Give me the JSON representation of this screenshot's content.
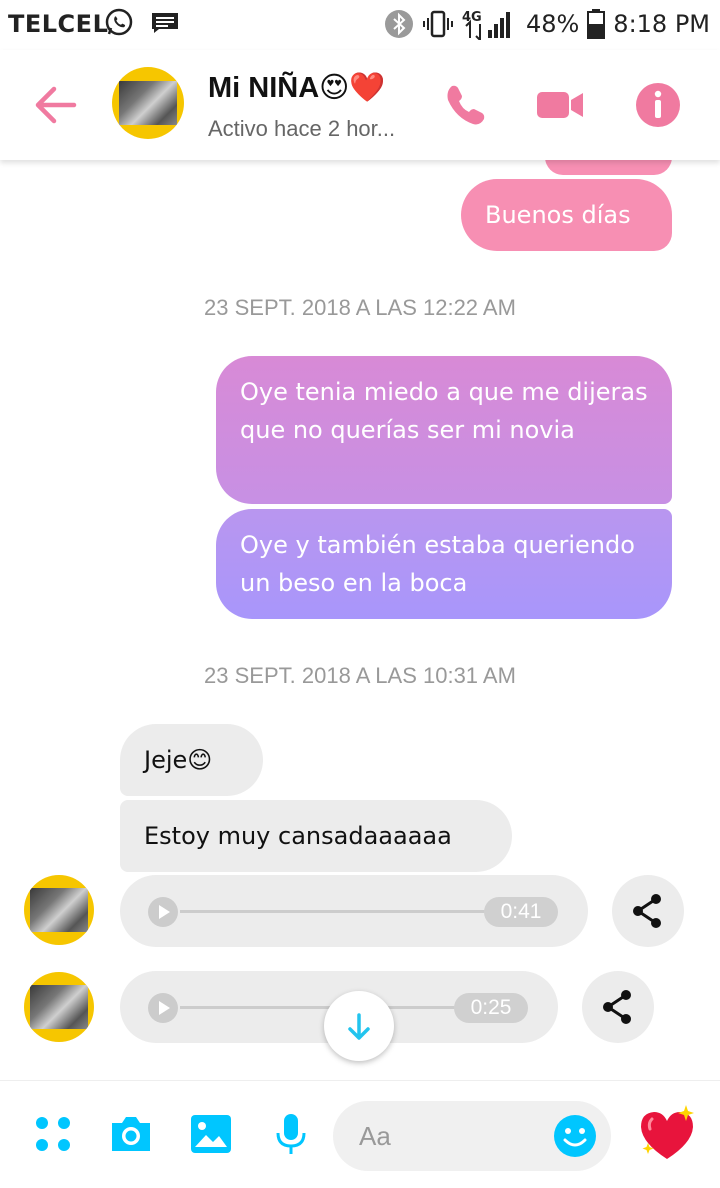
{
  "status_bar": {
    "carrier": "TELCEL",
    "network": "4G",
    "battery": "48%",
    "time": "8:18 PM"
  },
  "header": {
    "contact_name": "Mi NIÑA😍❤️",
    "contact_status": "Activo hace 2 hor...",
    "accent_color": "#f07aa0"
  },
  "messages": {
    "sent_1": "Buenos días",
    "timestamp_1": "23 SEPT. 2018 A LAS 12:22 AM",
    "sent_2": "Oye tenia miedo a que me dijeras que no querías ser mi novia",
    "sent_3": "Oye y también estaba queriendo un beso en la boca",
    "timestamp_2": "23 SEPT. 2018 A LAS 10:31 AM",
    "received_1": "Jeje😊",
    "received_2": "Estoy muy cansadaaaaaa",
    "audio_1_duration": "0:41",
    "audio_2_duration": "0:25"
  },
  "composer": {
    "placeholder": "Aa"
  },
  "colors": {
    "pink_bubble": "#f78fb3",
    "purple_top": "#d489d8",
    "purple_bottom": "#a996fb",
    "cyan_icons": "#00c6ff"
  }
}
